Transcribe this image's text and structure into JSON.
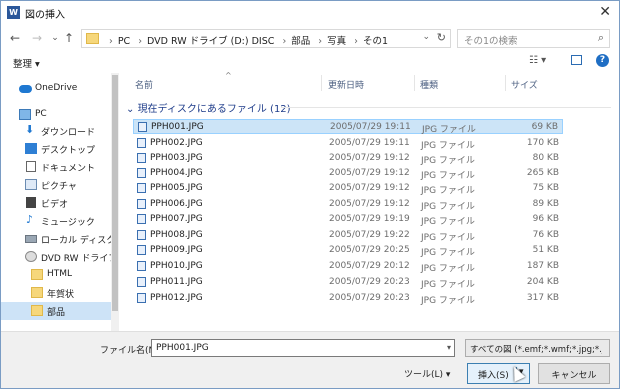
{
  "window": {
    "title": "図の挿入",
    "app_icon": "W"
  },
  "nav": {
    "back_icon": "←",
    "forward_icon": "→",
    "recent_icon": "⌄",
    "up_icon": "↑",
    "breadcrumbs": [
      "PC",
      "DVD RW ドライブ (D:) DISC",
      "部品",
      "写真",
      "その1"
    ],
    "search_placeholder": "その1の検索"
  },
  "toolbar": {
    "organize_label": "整理 ▾"
  },
  "sidebar": {
    "items": [
      {
        "label": "OneDrive",
        "icon": "cloud-icon"
      },
      {
        "label": "PC",
        "icon": "computer-icon"
      },
      {
        "label": "ダウンロード",
        "icon": "download-icon"
      },
      {
        "label": "デスクトップ",
        "icon": "desktop-icon"
      },
      {
        "label": "ドキュメント",
        "icon": "document-icon"
      },
      {
        "label": "ピクチャ",
        "icon": "picture-icon"
      },
      {
        "label": "ビデオ",
        "icon": "video-icon"
      },
      {
        "label": "ミュージック",
        "icon": "music-icon"
      },
      {
        "label": "ローカル ディスク (C",
        "icon": "disk-icon"
      },
      {
        "label": "DVD RW ドライブ (",
        "icon": "dvd-icon"
      },
      {
        "label": "HTML",
        "icon": "folder-icon"
      },
      {
        "label": "年賀状",
        "icon": "folder-icon"
      },
      {
        "label": "部品",
        "icon": "folder-icon"
      }
    ]
  },
  "columns": {
    "name": "名前",
    "date": "更新日時",
    "type": "種類",
    "size": "サイズ"
  },
  "group": {
    "label": "現在ディスクにあるファイル (12)"
  },
  "files": [
    {
      "name": "PPH001.JPG",
      "date": "2005/07/29 19:11",
      "type": "JPG ファイル",
      "size": "69 KB"
    },
    {
      "name": "PPH002.JPG",
      "date": "2005/07/29 19:11",
      "type": "JPG ファイル",
      "size": "170 KB"
    },
    {
      "name": "PPH003.JPG",
      "date": "2005/07/29 19:12",
      "type": "JPG ファイル",
      "size": "80 KB"
    },
    {
      "name": "PPH004.JPG",
      "date": "2005/07/29 19:12",
      "type": "JPG ファイル",
      "size": "265 KB"
    },
    {
      "name": "PPH005.JPG",
      "date": "2005/07/29 19:12",
      "type": "JPG ファイル",
      "size": "75 KB"
    },
    {
      "name": "PPH006.JPG",
      "date": "2005/07/29 19:12",
      "type": "JPG ファイル",
      "size": "89 KB"
    },
    {
      "name": "PPH007.JPG",
      "date": "2005/07/29 19:19",
      "type": "JPG ファイル",
      "size": "96 KB"
    },
    {
      "name": "PPH008.JPG",
      "date": "2005/07/29 19:22",
      "type": "JPG ファイル",
      "size": "76 KB"
    },
    {
      "name": "PPH009.JPG",
      "date": "2005/07/29 20:25",
      "type": "JPG ファイル",
      "size": "51 KB"
    },
    {
      "name": "PPH010.JPG",
      "date": "2005/07/29 20:12",
      "type": "JPG ファイル",
      "size": "187 KB"
    },
    {
      "name": "PPH011.JPG",
      "date": "2005/07/29 20:23",
      "type": "JPG ファイル",
      "size": "204 KB"
    },
    {
      "name": "PPH012.JPG",
      "date": "2005/07/29 20:23",
      "type": "JPG ファイル",
      "size": "317 KB"
    }
  ],
  "footer": {
    "filename_label": "ファイル名(N):",
    "filename_value": "PPH001.JPG",
    "filter_value": "すべての図 (*.emf;*.wmf;*.jpg;*.jp",
    "tools_label": "ツール(L)",
    "insert_label": "挿入(S)",
    "cancel_label": "キャンセル"
  }
}
